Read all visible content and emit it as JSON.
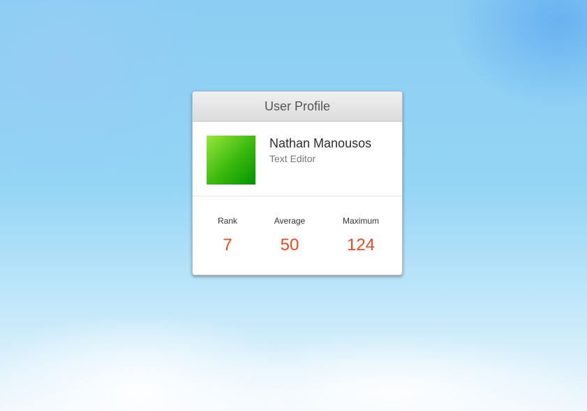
{
  "card": {
    "title": "User Profile"
  },
  "user": {
    "name": "Nathan Manousos",
    "role": "Text Editor",
    "avatar_colors": [
      "#96e83a",
      "#009300"
    ]
  },
  "stats": [
    {
      "label": "Rank",
      "value": "7"
    },
    {
      "label": "Average",
      "value": "50"
    },
    {
      "label": "Maximum",
      "value": "124"
    }
  ],
  "colors": {
    "accent": "#ef4a24"
  }
}
